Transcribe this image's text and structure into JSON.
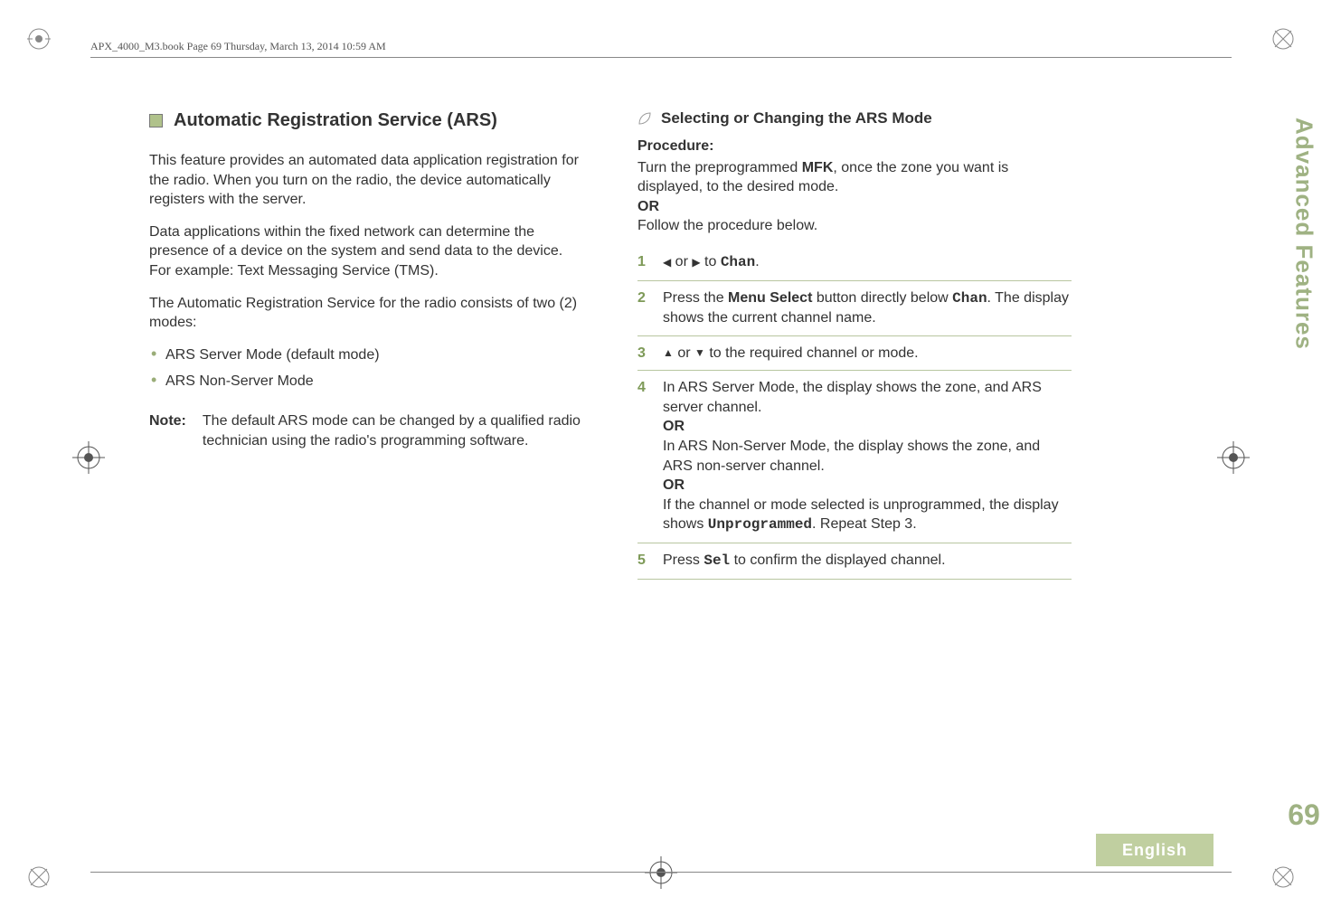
{
  "header": {
    "running": "APX_4000_M3.book  Page 69  Thursday, March 13, 2014  10:59 AM"
  },
  "side": {
    "tab": "Advanced Features",
    "page": "69",
    "language": "English"
  },
  "left": {
    "title": "Automatic Registration Service (ARS)",
    "p1": "This feature provides an automated data application registration for the radio. When you turn on the radio, the device automatically registers with the server.",
    "p2": "Data applications within the fixed network can determine the presence of a device on the system and send data to the device. For example: Text Messaging Service (TMS).",
    "p3": "The Automatic Registration Service for the radio consists of two (2) modes:",
    "bullets": [
      "ARS Server Mode (default mode)",
      "ARS Non-Server Mode"
    ],
    "note_label": "Note:",
    "note_text": "The default ARS mode can be changed by a qualified radio technician using the radio's programming software."
  },
  "right": {
    "sub_title": "Selecting or Changing the ARS Mode",
    "proc_label": "Procedure:",
    "intro1a": "Turn the preprogrammed ",
    "intro1_mfk": "MFK",
    "intro1b": ", once the zone you want is displayed, to the desired mode.",
    "or": "OR",
    "intro2": "Follow the procedure below.",
    "steps": {
      "s1_a": " or ",
      "s1_b": " to ",
      "s1_chan": "Chan",
      "s1_c": ".",
      "s2_a": "Press the ",
      "s2_b": "Menu Select",
      "s2_c": " button directly below ",
      "s2_d": "Chan",
      "s2_e": ". The display shows the current channel name.",
      "s3_a": " or ",
      "s3_b": " to the required channel or mode.",
      "s4_a": "In ARS Server Mode, the display shows the zone, and ARS server channel.",
      "s4_or1": "OR",
      "s4_b": "In ARS Non-Server Mode, the display shows the zone, and ARS non-server channel.",
      "s4_or2": "OR",
      "s4_c1": "If the channel or mode selected is unprogrammed, the display shows ",
      "s4_unprog": "Unprogrammed",
      "s4_c2": ". Repeat Step 3.",
      "s5_a": "Press ",
      "s5_sel": "Sel",
      "s5_b": " to confirm the displayed channel."
    },
    "nums": [
      "1",
      "2",
      "3",
      "4",
      "5"
    ]
  }
}
